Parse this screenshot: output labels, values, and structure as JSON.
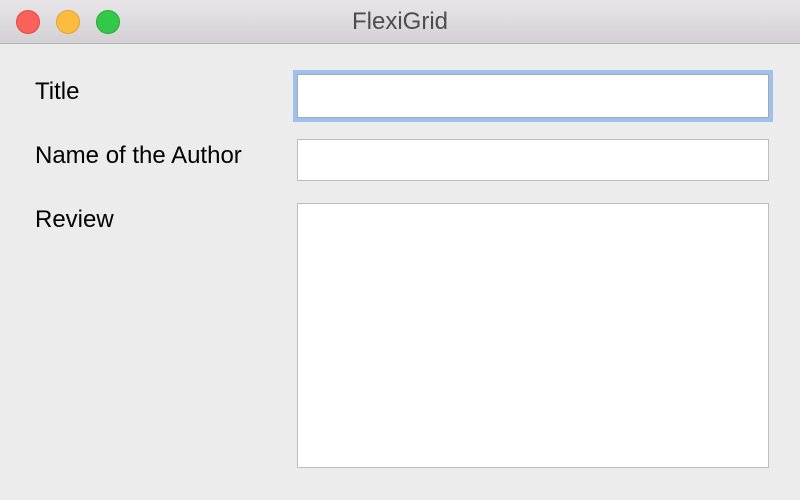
{
  "window": {
    "title": "FlexiGrid"
  },
  "form": {
    "title_label": "Title",
    "title_value": "",
    "author_label": "Name of the Author",
    "author_value": "",
    "review_label": "Review",
    "review_value": ""
  },
  "colors": {
    "focus_ring": "#9cc1ec",
    "close": "#fc605b",
    "minimize": "#fdbc40",
    "zoom": "#34c84a"
  }
}
